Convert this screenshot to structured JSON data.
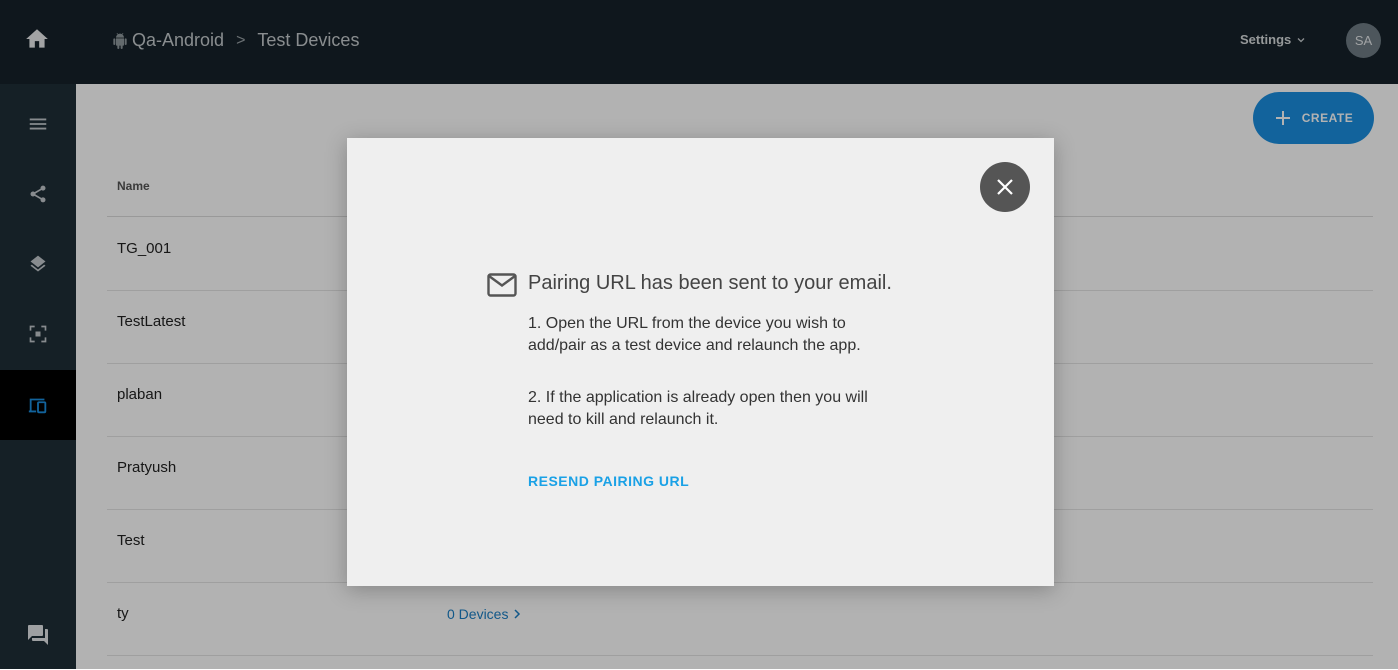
{
  "header": {
    "breadcrumb": [
      "Qa-Android",
      ">",
      "Test Devices"
    ],
    "settings_label": "Settings",
    "avatar_initials": "SA"
  },
  "sidebar": {
    "items": [
      {
        "icon": "menu-icon"
      },
      {
        "icon": "share-nodes-icon"
      },
      {
        "icon": "layers-icon"
      },
      {
        "icon": "scan-icon"
      },
      {
        "icon": "devices-icon",
        "active": true
      },
      {
        "icon": "chat-icon"
      }
    ]
  },
  "toolbar": {
    "create_label": "CREATE"
  },
  "table": {
    "columns": [
      "Name"
    ],
    "rows": [
      {
        "name": "TG_001"
      },
      {
        "name": "TestLatest"
      },
      {
        "name": "plaban"
      },
      {
        "name": "Pratyush"
      },
      {
        "name": "Test"
      },
      {
        "name": "ty",
        "devices": "0 Devices"
      }
    ]
  },
  "modal": {
    "title": "Pairing URL has been sent to your email.",
    "step1": "1. Open the URL from the device you wish to add/pair as a test device and relaunch the app.",
    "step2": "2. If the application is already open then you will need to kill and relaunch it.",
    "resend_label": "RESEND PAIRING URL"
  },
  "colors": {
    "topbar": "#16222a",
    "sidebar": "#1f2e37",
    "accent": "#1a8fe0",
    "link": "#1aa1e6"
  }
}
